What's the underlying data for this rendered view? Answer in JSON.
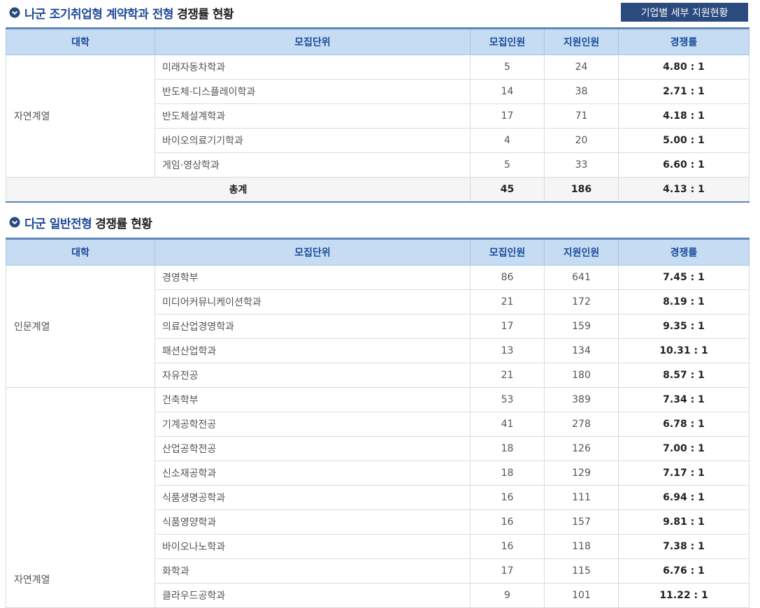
{
  "section1": {
    "title_part1": "나군 조기취업형 계약학과 전형",
    "title_part2": "경쟁률 현황",
    "button_label": "기업별 세부 지원현황",
    "headers": [
      "대학",
      "모집단위",
      "모집인원",
      "지원인원",
      "경쟁률"
    ],
    "group": "자연계열",
    "rows": [
      {
        "unit": "미래자동차학과",
        "quota": "5",
        "applicants": "24",
        "ratio": "4.80 : 1"
      },
      {
        "unit": "반도체·디스플레이학과",
        "quota": "14",
        "applicants": "38",
        "ratio": "2.71 : 1"
      },
      {
        "unit": "반도체설계학과",
        "quota": "17",
        "applicants": "71",
        "ratio": "4.18 : 1"
      },
      {
        "unit": "바이오의료기기학과",
        "quota": "4",
        "applicants": "20",
        "ratio": "5.00 : 1"
      },
      {
        "unit": "게임·영상학과",
        "quota": "5",
        "applicants": "33",
        "ratio": "6.60 : 1"
      }
    ],
    "total": {
      "label": "총계",
      "quota": "45",
      "applicants": "186",
      "ratio": "4.13 : 1"
    }
  },
  "section2": {
    "title_part1": "다군 일반전형",
    "title_part2": "경쟁률 현황",
    "headers": [
      "대학",
      "모집단위",
      "모집인원",
      "지원인원",
      "경쟁률"
    ],
    "group1": "인문계열",
    "rows1": [
      {
        "unit": "경영학부",
        "quota": "86",
        "applicants": "641",
        "ratio": "7.45 : 1"
      },
      {
        "unit": "미디어커뮤니케이션학과",
        "quota": "21",
        "applicants": "172",
        "ratio": "8.19 : 1"
      },
      {
        "unit": "의료산업경영학과",
        "quota": "17",
        "applicants": "159",
        "ratio": "9.35 : 1"
      },
      {
        "unit": "패션산업학과",
        "quota": "13",
        "applicants": "134",
        "ratio": "10.31 : 1"
      },
      {
        "unit": "자유전공",
        "quota": "21",
        "applicants": "180",
        "ratio": "8.57 : 1"
      }
    ],
    "group2": "자연계열",
    "rows2": [
      {
        "unit": "건축학부",
        "quota": "53",
        "applicants": "389",
        "ratio": "7.34 : 1"
      },
      {
        "unit": "기계공학전공",
        "quota": "41",
        "applicants": "278",
        "ratio": "6.78 : 1"
      },
      {
        "unit": "산업공학전공",
        "quota": "18",
        "applicants": "126",
        "ratio": "7.00 : 1"
      },
      {
        "unit": "신소재공학과",
        "quota": "18",
        "applicants": "129",
        "ratio": "7.17 : 1"
      },
      {
        "unit": "식품생명공학과",
        "quota": "16",
        "applicants": "111",
        "ratio": "6.94 : 1"
      },
      {
        "unit": "식품영양학과",
        "quota": "16",
        "applicants": "157",
        "ratio": "9.81 : 1"
      },
      {
        "unit": "바이오나노학과",
        "quota": "16",
        "applicants": "118",
        "ratio": "7.38 : 1"
      },
      {
        "unit": "화학과",
        "quota": "17",
        "applicants": "115",
        "ratio": "6.76 : 1"
      },
      {
        "unit": "클라우드공학과",
        "quota": "9",
        "applicants": "101",
        "ratio": "11.22 : 1"
      }
    ]
  },
  "icons": {
    "section_bullet": "chevron-circle-down-icon"
  },
  "colors": {
    "accent": "#1f4a98",
    "header_bg": "#c6dcf3",
    "header_border": "#5e86bb",
    "button_bg": "#2b4a7d",
    "total_bg": "#f5f5f5"
  }
}
